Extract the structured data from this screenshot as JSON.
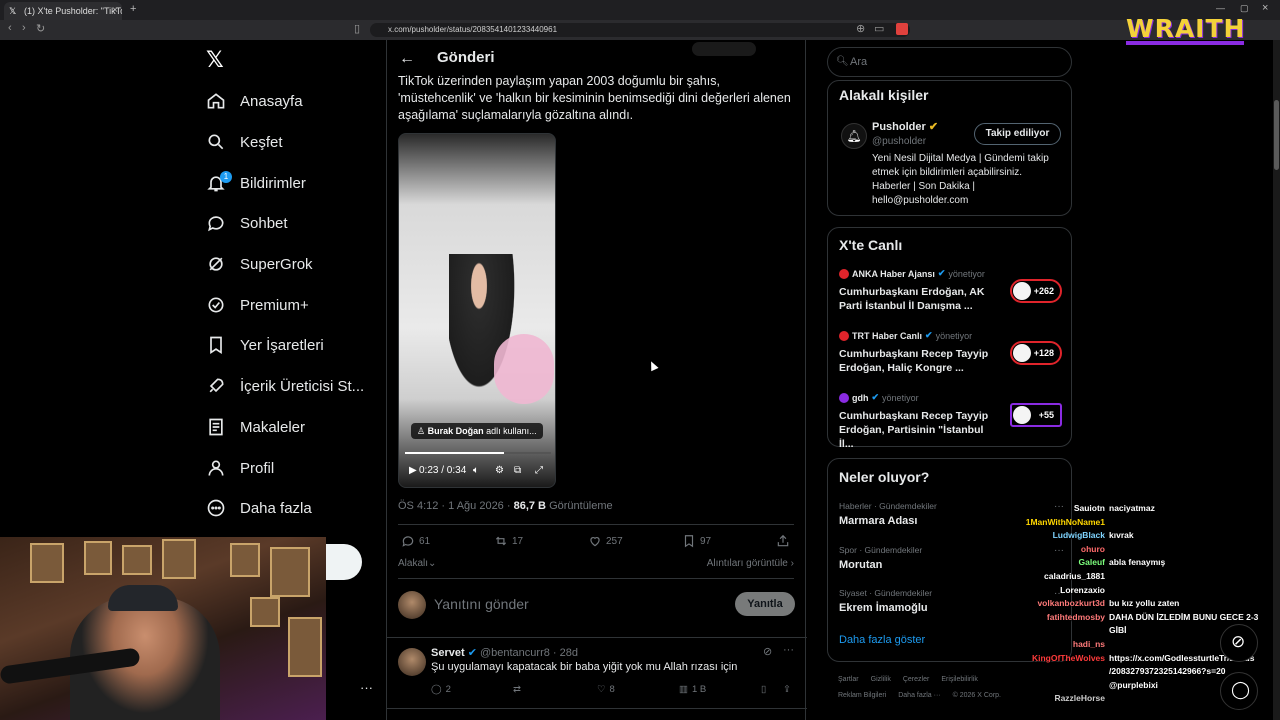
{
  "browser": {
    "tab_title": "(1) X'te Pusholder: \"TikTok üzeri",
    "url": "x.com/pusholder/status/2083541401233440961",
    "overlay_brand": "WRAITH"
  },
  "nav": {
    "items": [
      {
        "label": "Anasayfa",
        "icon": "home-icon"
      },
      {
        "label": "Keşfet",
        "icon": "search-icon"
      },
      {
        "label": "Bildirimler",
        "icon": "bell-icon",
        "badge": "1"
      },
      {
        "label": "Sohbet",
        "icon": "chat-icon"
      },
      {
        "label": "SuperGrok",
        "icon": "grok-icon"
      },
      {
        "label": "Premium+",
        "icon": "premium-icon"
      },
      {
        "label": "Yer İşaretleri",
        "icon": "bookmark-icon"
      },
      {
        "label": "İçerik Üreticisi St...",
        "icon": "rocket-icon"
      },
      {
        "label": "Makaleler",
        "icon": "article-icon"
      },
      {
        "label": "Profil",
        "icon": "user-icon"
      },
      {
        "label": "Daha fazla",
        "icon": "more-icon"
      }
    ]
  },
  "post": {
    "header_title": "Gönderi",
    "text": "TikTok üzerinden paylaşım yapan 2003 doğumlu bir şahıs, 'müstehcenlik' ve 'halkın bir kesiminin benimsediği dini değerleri alenen aşağılama' suçlamalarıyla gözaltına alındı.",
    "video": {
      "label_name": "Burak Doğan",
      "label_suffix": "adlı kullanı...",
      "time": "0:23 / 0:34",
      "progress": 0.68
    },
    "time": "ÖS 4:12 · 1 Ağu 2026 · ",
    "views": "86,7 B",
    "views_label": "Görüntüleme",
    "stats": {
      "replies": "61",
      "reposts": "17",
      "likes": "257",
      "bookmarks": "97"
    },
    "sort_label": "Alakalı",
    "quotes_label": "Alıntıları görüntüle",
    "reply_placeholder": "Yanıtını gönder",
    "reply_button": "Yanıtla"
  },
  "comment": {
    "name": "Servet",
    "handle": "@bentancurr8 · 28d",
    "text": "Şu uygulamayı kapatacak bir baba yiğit yok mu Allah rızası için",
    "replies": "2",
    "likes": "8",
    "views": "1 B"
  },
  "sidebar": {
    "search_placeholder": "Ara",
    "related": {
      "title": "Alakalı kişiler",
      "name": "Pusholder",
      "handle": "@pusholder",
      "button": "Takip ediliyor",
      "bio": "Yeni Nesil Dijital Medya | Gündemi takip etmek için bildirimleri açabilirsiniz. Haberler | Son Dakika | hello@pusholder.com"
    },
    "live": {
      "title": "X'te Canlı",
      "items": [
        {
          "source": "ANKA Haber Ajansı",
          "status": "yönetiyor",
          "title": "Cumhurbaşkanı Erdoğan, AK Parti İstanbul İl Danışma ...",
          "count": "+262"
        },
        {
          "source": "TRT Haber Canlı",
          "status": "yönetiyor",
          "title": "Cumhurbaşkanı Recep Tayyip Erdoğan, Haliç Kongre ...",
          "count": "+128"
        },
        {
          "source": "gdh",
          "status": "yönetiyor",
          "title": "Cumhurbaşkanı Recep Tayyip Erdoğan, Partisinin \"İstanbul İl...",
          "count": "+55"
        }
      ]
    },
    "trends": {
      "title": "Neler oluyor?",
      "items": [
        {
          "category": "Haberler · Gündemdekiler",
          "name": "Marmara Adası"
        },
        {
          "category": "Spor · Gündemdekiler",
          "name": "Morutan"
        },
        {
          "category": "Siyaset · Gündemdekiler",
          "name": "Ekrem İmamoğlu"
        }
      ],
      "show_more": "Daha fazla göster"
    },
    "footer1": [
      "Şartlar",
      "Gizlilik",
      "Çerezler",
      "Erişilebilirlik"
    ],
    "footer2": [
      "Reklam Bilgileri",
      "Daha fazla ···",
      "© 2026 X Corp."
    ]
  },
  "chat": [
    {
      "user": "Sauiotn",
      "msg": "naciyatmaz",
      "color": "#ffffff"
    },
    {
      "user": "1ManWithNoName1",
      "msg": "",
      "color": "#ffd700"
    },
    {
      "user": "LudwigBlack",
      "msg": "kıvrak",
      "color": "#7fd4ff"
    },
    {
      "user": "ohuro",
      "msg": "",
      "color": "#ff6b6b"
    },
    {
      "user": "Galeuf",
      "msg": "abla fenaymış",
      "color": "#7dff7d"
    },
    {
      "user": "caladrius_1881",
      "msg": "",
      "color": "#ffffff"
    },
    {
      "user": "Lorenzaxio",
      "msg": "",
      "color": "#ffffff"
    },
    {
      "user": "volkanbozkurt3d",
      "msg": "bu kız yollu zaten",
      "color": "#ff7a7a"
    },
    {
      "user": "fatihtedmosby",
      "msg": "DAHA DÜN İZLEDİM BUNU GECE 2-3",
      "color": "#ff7a7a"
    },
    {
      "user": "",
      "msg": "GİBİ",
      "color": "#ffffff"
    },
    {
      "user": "hadi_ns",
      "msg": "",
      "color": "#ff7a7a"
    },
    {
      "user": "KingOfTheWolves",
      "msg": "https://x.com/GodlessturtleTr/status",
      "color": "#ff3b3b"
    },
    {
      "user": "",
      "msg": "/2083279372325142966?s=20",
      "color": "#ffffff"
    },
    {
      "user": "",
      "msg": "@purplebixi",
      "color": "#ffffff"
    },
    {
      "user": "RazzleHorse",
      "msg": "",
      "color": "#cccccc"
    }
  ]
}
